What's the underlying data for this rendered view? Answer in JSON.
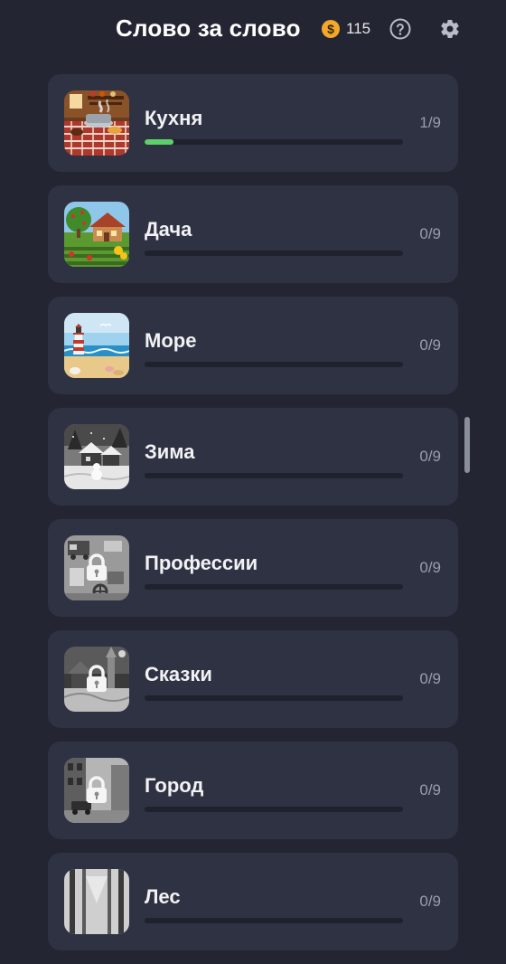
{
  "header": {
    "title": "Слово за слово",
    "coin_symbol": "$",
    "coins": "115",
    "help_icon": "question-circle-icon",
    "settings_icon": "gear-icon"
  },
  "colors": {
    "background": "#232632",
    "card": "#2e3242",
    "progress_fill": "#5ed06a",
    "coin": "#f2a92b"
  },
  "categories": [
    {
      "name": "Кухня",
      "count": "1/9",
      "progress": 0.111,
      "image": "kitchen",
      "locked": false
    },
    {
      "name": "Дача",
      "count": "0/9",
      "progress": 0,
      "image": "country-house",
      "locked": false
    },
    {
      "name": "Море",
      "count": "0/9",
      "progress": 0,
      "image": "sea-lighthouse",
      "locked": false
    },
    {
      "name": "Зима",
      "count": "0/9",
      "progress": 0,
      "image": "winter-village",
      "locked": false
    },
    {
      "name": "Профессии",
      "count": "0/9",
      "progress": 0,
      "image": "professions",
      "locked": true
    },
    {
      "name": "Сказки",
      "count": "0/9",
      "progress": 0,
      "image": "fairy-tales",
      "locked": true
    },
    {
      "name": "Город",
      "count": "0/9",
      "progress": 0,
      "image": "city",
      "locked": true
    },
    {
      "name": "Лес",
      "count": "0/9",
      "progress": 0,
      "image": "forest",
      "locked": true
    }
  ]
}
